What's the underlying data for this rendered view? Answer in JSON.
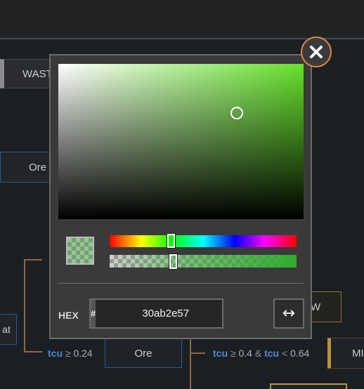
{
  "background": {
    "nodes": {
      "waste": "WAST",
      "ore_left": "Ore",
      "left_fragment": "at",
      "ore_bottom": "Ore",
      "right_fragment_w": "W",
      "right_fragment_m": "MI"
    },
    "conditions": {
      "left": {
        "var": "tcu",
        "op": "≥",
        "value": "0.24"
      },
      "right": {
        "var1": "tcu",
        "op1": "≥",
        "value1": "0.4",
        "joiner": "&",
        "var2": "tcu",
        "op2": "<",
        "value2": "0.64"
      }
    }
  },
  "color_picker": {
    "hex_label": "HEX",
    "hash_symbol": "#",
    "hex_value": "30ab2e57",
    "swap_icon": "↔",
    "close_icon": "close-x",
    "hue_fraction": 0.33,
    "alpha_fraction": 0.34,
    "colors": {
      "base_hue": "#65e22a",
      "current": "#30ab2e",
      "close_ring": "#e08a3a",
      "panel": "#3a3a3a"
    }
  }
}
